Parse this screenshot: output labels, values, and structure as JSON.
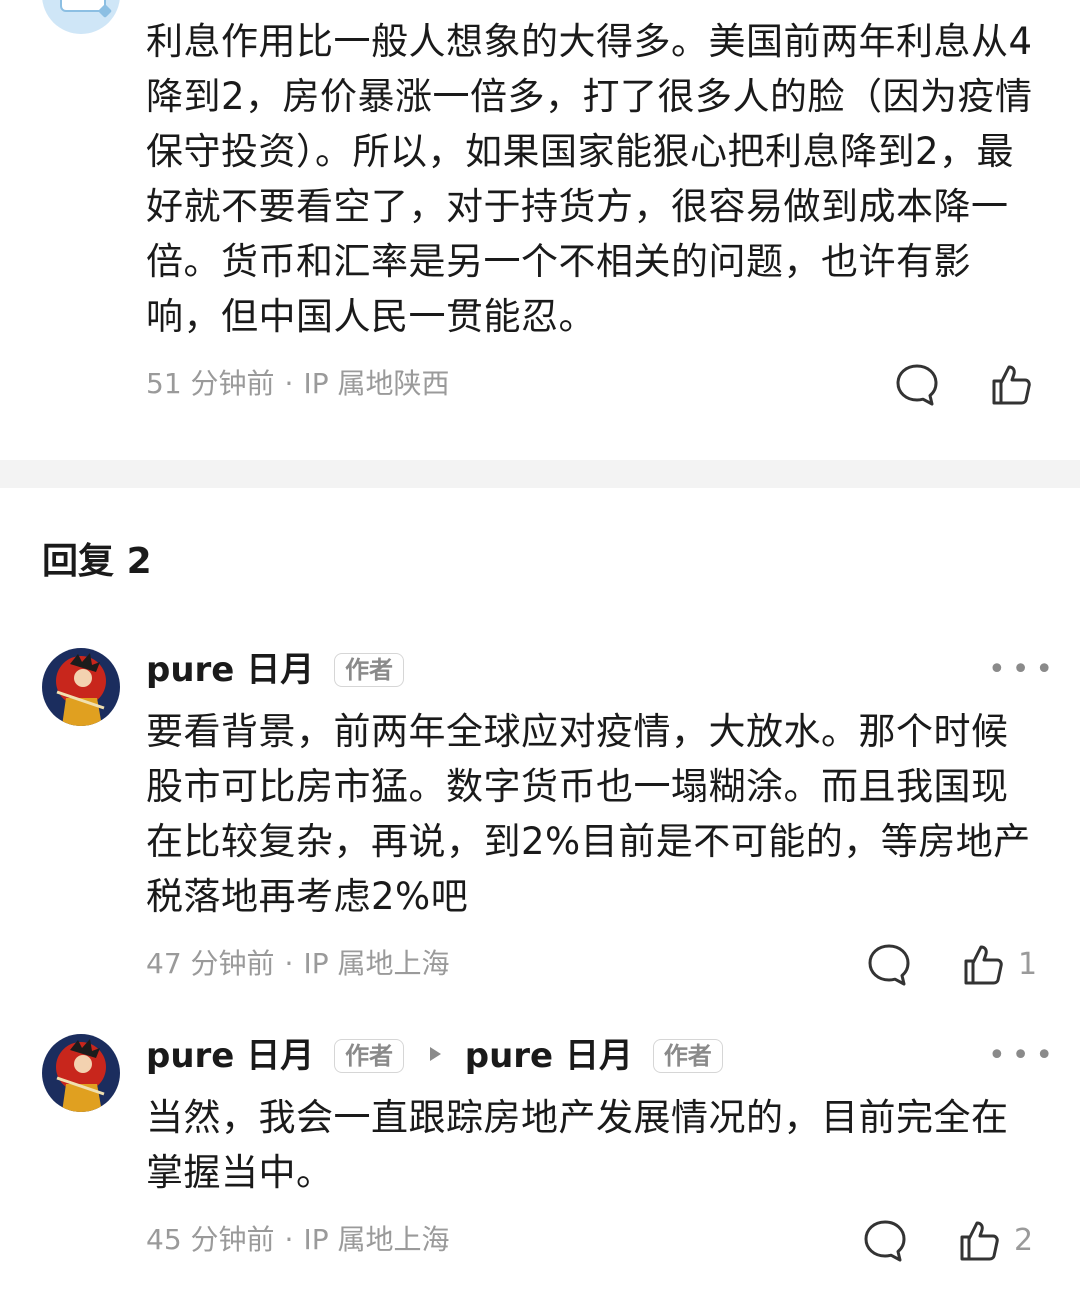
{
  "top_comment": {
    "text": "利息作用比一般人想象的大得多。美国前两年利息从4降到2，房价暴涨一倍多，打了很多人的脸（因为疫情保守投资）。所以，如果国家能狠心把利息降到2，最好就不要看空了，对于持货方，很容易做到成本降一倍。货币和汇率是另一个不相关的问题，也许有影响，但中国人民一贯能忍。",
    "time": "51 分钟前",
    "separator": "·",
    "location": "IP 属地陕西"
  },
  "replies_header": {
    "label": "回复",
    "count": "2"
  },
  "replies": [
    {
      "author": "pure 日月",
      "author_badge": "作者",
      "text": "要看背景，前两年全球应对疫情，大放水。那个时候股市可比房市猛。数字货币也一塌糊涂。而且我国现在比较复杂，再说，到2%目前是不可能的，等房地产税落地再考虑2%吧",
      "time": "47 分钟前",
      "separator": "·",
      "location": "IP 属地上海",
      "likes": "1",
      "more": "•••"
    },
    {
      "author": "pure 日月",
      "author_badge": "作者",
      "reply_to": "pure 日月",
      "reply_to_badge": "作者",
      "text": "当然，我会一直跟踪房地产发展情况的，目前完全在掌握当中。",
      "time": "45 分钟前",
      "separator": "·",
      "location": "IP 属地上海",
      "likes": "2",
      "more": "•••"
    }
  ],
  "icons": {
    "comment": "comment-bubble-icon",
    "like": "thumbs-up-icon",
    "more": "more-options-icon"
  }
}
